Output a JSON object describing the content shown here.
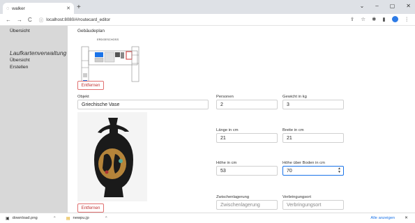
{
  "browser": {
    "tab_title": "walker",
    "url": "localhost:8080/#/routecard_editor",
    "window_controls": [
      "⌄",
      "–",
      "▢",
      "✕"
    ]
  },
  "sidebar": {
    "top_link": "Übersicht",
    "section_title": "Laufkartenverwaltung",
    "items": [
      "Übersicht",
      "Erstellen"
    ]
  },
  "floorplan": {
    "label": "Gebäudeplan",
    "floor_label": "ERDGESCHOSS",
    "remove_label": "Entfernen"
  },
  "object": {
    "label": "Objekt",
    "value": "Griechische Vase",
    "remove_label": "Entfernen"
  },
  "fields": {
    "personen": {
      "label": "Personen",
      "value": "2"
    },
    "gewicht": {
      "label": "Gewicht in kg",
      "value": "3"
    },
    "laenge": {
      "label": "Länge in cm",
      "value": "21"
    },
    "breite": {
      "label": "Breite in cm",
      "value": "21"
    },
    "hoehe": {
      "label": "Höhe in cm",
      "value": "53"
    },
    "hoehe_boden": {
      "label": "Höhe über Boden in cm",
      "value": "70"
    },
    "zwischenlagerung": {
      "label": "Zwischenlagerung",
      "placeholder": "Zwischenlagerung"
    },
    "verbringungsort": {
      "label": "Verbringungsort",
      "placeholder": "Verbringungsort"
    }
  },
  "downloads": {
    "items": [
      "download.png",
      "newpu.jp"
    ],
    "show_all": "Alle anzeigen",
    "close": "✕"
  },
  "colors": {
    "accent": "#1a73e8",
    "danger": "#c03030",
    "sidebar": "#d8d8d8"
  }
}
